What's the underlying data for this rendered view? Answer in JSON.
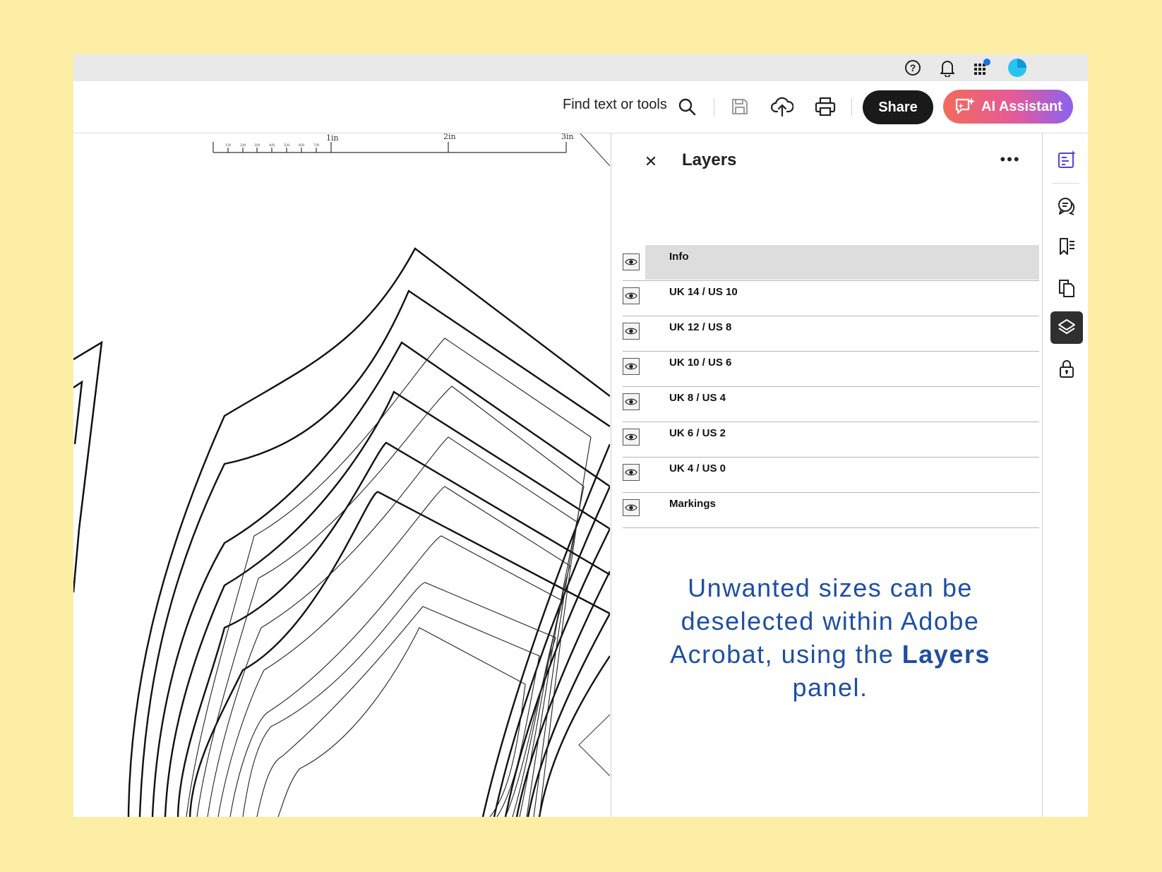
{
  "toolbar": {
    "find_label": "Find text or tools",
    "share_label": "Share",
    "ai_label": "AI Assistant"
  },
  "ruler": {
    "major": [
      "1in",
      "2in",
      "3in"
    ],
    "minor": [
      "1/8",
      "2/8",
      "3/8",
      "4/8",
      "5/8",
      "6/8",
      "7/8"
    ]
  },
  "panel": {
    "title": "Layers",
    "close_glyph": "✕",
    "more_glyph": "•••",
    "layers": [
      {
        "name": "Info",
        "selected": true
      },
      {
        "name": "UK 14 / US 10",
        "selected": false
      },
      {
        "name": "UK 12 / US 8",
        "selected": false
      },
      {
        "name": "UK 10 / US 6",
        "selected": false
      },
      {
        "name": "UK 8 / US 4",
        "selected": false
      },
      {
        "name": "UK 6 / US 2",
        "selected": false
      },
      {
        "name": "UK 4 / US 0",
        "selected": false
      },
      {
        "name": "Markings",
        "selected": false
      }
    ]
  },
  "caption": {
    "part1": "Unwanted sizes can be deselected within Adobe Acrobat, using the",
    "bold": "Layers",
    "part2": "panel."
  },
  "colors": {
    "background": "#fdeea6",
    "caption": "#1f4fa0",
    "notification_dot": "#1473e6",
    "avatar": "#29c3f0",
    "rail_icon": "#5b3fd6"
  },
  "icons": {
    "sysbar": [
      "help-icon",
      "bell-icon",
      "apps-grid-icon",
      "avatar"
    ],
    "toolbar": [
      "search-icon",
      "save-icon",
      "upload-cloud-icon",
      "print-icon",
      "ai-assistant-icon"
    ],
    "rail": [
      "edit-ai-icon",
      "comment-icon",
      "bookmark-icon",
      "pages-icon",
      "layers-icon",
      "lock-icon"
    ]
  }
}
